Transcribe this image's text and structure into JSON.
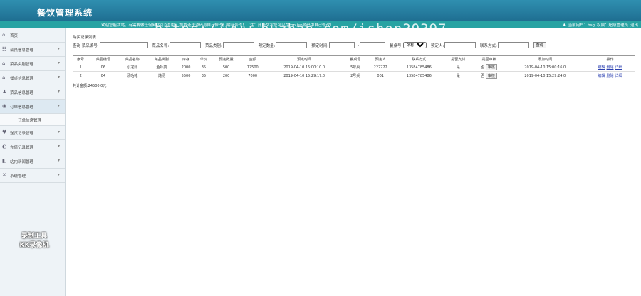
{
  "header": {
    "title": "餐饮管理系统"
  },
  "topbar": {
    "message": "欢迎您能我站，有需要做任何网站可以加我，加我还送源码与自己修改，期待合作！（注：此段文字您可以在top.jsp源码中自己修改）",
    "user_label": "当前用户：hsg",
    "role": "权限：超级管理员",
    "logout": "退出"
  },
  "watermark": "https://www.huzhan.com/ishop39397",
  "sidebar": {
    "items": [
      {
        "icon": "home-icon",
        "glyph": "⌂",
        "label": "首页",
        "chev": ""
      },
      {
        "icon": "users-icon",
        "glyph": "☷",
        "label": "会员信息管理",
        "chev": "▾"
      },
      {
        "icon": "dish-icon",
        "glyph": "⌂",
        "label": "菜品类别管理",
        "chev": "▾"
      },
      {
        "icon": "table-icon",
        "glyph": "⌂",
        "label": "餐桌信息管理",
        "chev": "▾"
      },
      {
        "icon": "user-icon",
        "glyph": "♟",
        "label": "菜品信息管理",
        "chev": "▾"
      },
      {
        "icon": "chat-icon",
        "glyph": "◉",
        "label": "订单信息管理",
        "chev": "▾"
      },
      {
        "icon": "heart-icon",
        "glyph": "♥",
        "label": "送货记录管理",
        "chev": "▾"
      },
      {
        "icon": "charge-icon",
        "glyph": "◐",
        "label": "充值记录管理",
        "chev": "▾"
      },
      {
        "icon": "news-icon",
        "glyph": "◧",
        "label": "站内新闻管理",
        "chev": "▾"
      },
      {
        "icon": "settings-icon",
        "glyph": "✕",
        "label": "系统管理",
        "chev": "▾"
      }
    ],
    "sub_item": "订单信息管理"
  },
  "main": {
    "section_title": "购买记录列表",
    "search": {
      "query_label": "查询",
      "fields": [
        "菜品编号:",
        "菜品名称:",
        "菜品类别:",
        "预定数量:",
        "预定时间:"
      ],
      "table_no_label": "餐桌号:",
      "select_value": "所有",
      "booker_label": "预定人:",
      "phone_label": "联系方式:",
      "button": "查询"
    },
    "columns": [
      "序号",
      "菜品编号",
      "菜品名称",
      "菜品类别",
      "库存",
      "单价",
      "预定数量",
      "金额",
      "预定时间",
      "餐桌号",
      "预定人",
      "联系方式",
      "是否支付",
      "是否审核",
      "添加时间",
      "操作"
    ],
    "rows": [
      {
        "no": "1",
        "code": "06",
        "name": "小龙虾",
        "category": "鱼虾类",
        "stock": "2000",
        "price": "35",
        "qty": "500",
        "amount": "17500",
        "time": "2019-04-10 15:00:10.0",
        "table": "5号桌",
        "booker": "222222",
        "phone": "13584785486",
        "paid": "是",
        "audited": "否",
        "audit_btn": "审核",
        "added": "2019-04-10 15:00:16.0",
        "ops": [
          "编辑",
          "删除",
          "详细"
        ]
      },
      {
        "no": "2",
        "code": "04",
        "name": "汤咕咾",
        "category": "炖汤",
        "stock": "5500",
        "price": "35",
        "qty": "200",
        "amount": "7000",
        "time": "2019-04-10 15:29:17.0",
        "table": "2号桌",
        "booker": "001",
        "phone": "13584785486",
        "paid": "是",
        "audited": "否",
        "audit_btn": "审核",
        "added": "2019-04-10 15:29:24.0",
        "ops": [
          "编辑",
          "删除",
          "详细"
        ]
      }
    ],
    "total": "共计金额:24500.0元"
  },
  "overlay": {
    "line1": "录制工具",
    "line2": "KK录像机"
  }
}
